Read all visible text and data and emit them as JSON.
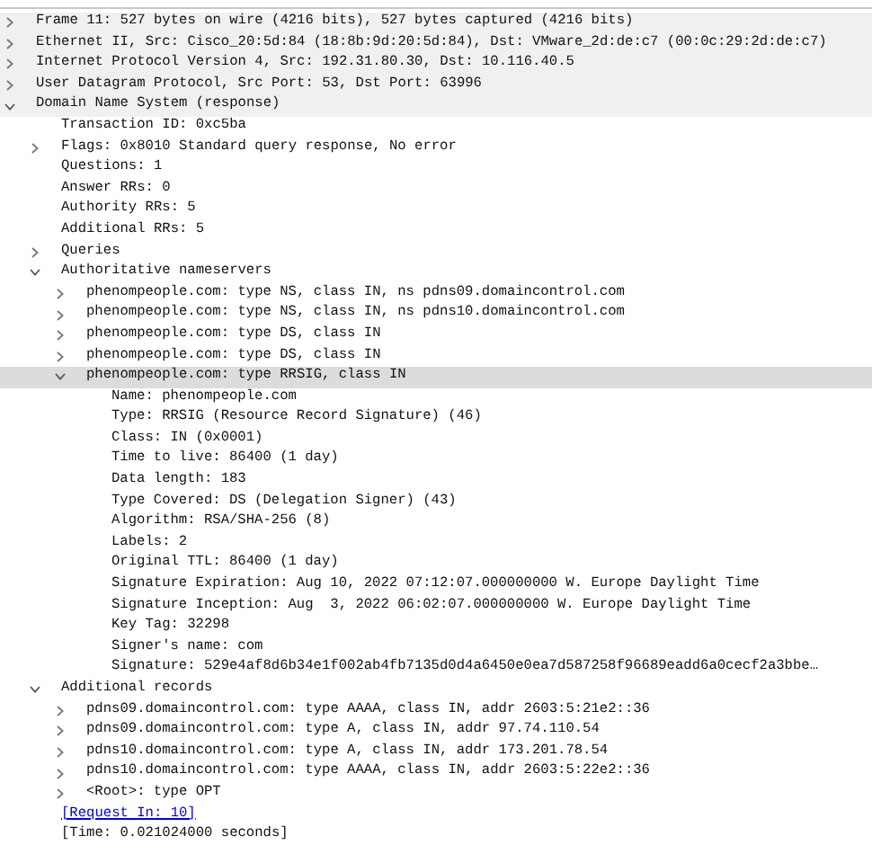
{
  "packet_details": [
    {
      "label": "Frame 11: 527 bytes on wire (4216 bits), 527 bytes captured (4216 bits)",
      "expanded": false,
      "selected": false
    },
    {
      "label": "Ethernet II, Src: Cisco_20:5d:84 (18:8b:9d:20:5d:84), Dst: VMware_2d:de:c7 (00:0c:29:2d:de:c7)",
      "expanded": false,
      "selected": false
    },
    {
      "label": "Internet Protocol Version 4, Src: 192.31.80.30, Dst: 10.116.40.5",
      "expanded": false,
      "selected": false
    },
    {
      "label": "User Datagram Protocol, Src Port: 53, Dst Port: 63996",
      "expanded": false,
      "selected": false
    },
    {
      "label": "Domain Name System (response)",
      "expanded": true,
      "selected": false,
      "children": [
        {
          "label": "Transaction ID: 0xc5ba",
          "selected": false
        },
        {
          "label": "Flags: 0x8010 Standard query response, No error",
          "expanded": false,
          "selected": false
        },
        {
          "label": "Questions: 1",
          "selected": false
        },
        {
          "label": "Answer RRs: 0",
          "selected": false
        },
        {
          "label": "Authority RRs: 5",
          "selected": false
        },
        {
          "label": "Additional RRs: 5",
          "selected": false
        },
        {
          "label": "Queries",
          "expanded": false,
          "selected": false
        },
        {
          "label": "Authoritative nameservers",
          "expanded": true,
          "selected": false,
          "children": [
            {
              "label": "phenompeople.com: type NS, class IN, ns pdns09.domaincontrol.com",
              "expanded": false,
              "selected": false
            },
            {
              "label": "phenompeople.com: type NS, class IN, ns pdns10.domaincontrol.com",
              "expanded": false,
              "selected": false
            },
            {
              "label": "phenompeople.com: type DS, class IN",
              "expanded": false,
              "selected": false
            },
            {
              "label": "phenompeople.com: type DS, class IN",
              "expanded": false,
              "selected": false
            },
            {
              "label": "phenompeople.com: type RRSIG, class IN",
              "expanded": true,
              "selected": true,
              "children": [
                {
                  "label": "Name: phenompeople.com",
                  "selected": false
                },
                {
                  "label": "Type: RRSIG (Resource Record Signature) (46)",
                  "selected": false
                },
                {
                  "label": "Class: IN (0x0001)",
                  "selected": false
                },
                {
                  "label": "Time to live: 86400 (1 day)",
                  "selected": false
                },
                {
                  "label": "Data length: 183",
                  "selected": false
                },
                {
                  "label": "Type Covered: DS (Delegation Signer) (43)",
                  "selected": false
                },
                {
                  "label": "Algorithm: RSA/SHA-256 (8)",
                  "selected": false
                },
                {
                  "label": "Labels: 2",
                  "selected": false
                },
                {
                  "label": "Original TTL: 86400 (1 day)",
                  "selected": false
                },
                {
                  "label": "Signature Expiration: Aug 10, 2022 07:12:07.000000000 W. Europe Daylight Time",
                  "selected": false
                },
                {
                  "label": "Signature Inception: Aug  3, 2022 06:02:07.000000000 W. Europe Daylight Time",
                  "selected": false
                },
                {
                  "label": "Key Tag: 32298",
                  "selected": false
                },
                {
                  "label": "Signer's name: com",
                  "selected": false
                },
                {
                  "label": "Signature: 529e4af8d6b34e1f002ab4fb7135d0d4a6450e0ea7d587258f96689eadd6a0cecf2a3bbe…",
                  "selected": false
                }
              ]
            }
          ]
        },
        {
          "label": "Additional records",
          "expanded": true,
          "selected": false,
          "children": [
            {
              "label": "pdns09.domaincontrol.com: type AAAA, class IN, addr 2603:5:21e2::36",
              "expanded": false,
              "selected": false
            },
            {
              "label": "pdns09.domaincontrol.com: type A, class IN, addr 97.74.110.54",
              "expanded": false,
              "selected": false
            },
            {
              "label": "pdns10.domaincontrol.com: type A, class IN, addr 173.201.78.54",
              "expanded": false,
              "selected": false
            },
            {
              "label": "pdns10.domaincontrol.com: type AAAA, class IN, addr 2603:5:22e2::36",
              "expanded": false,
              "selected": false
            },
            {
              "label": "<Root>: type OPT",
              "expanded": false,
              "selected": false
            }
          ]
        },
        {
          "label": "[Request In: 10]",
          "kind": "link",
          "selected": false
        },
        {
          "label": "[Time: 0.021024000 seconds]",
          "selected": false
        }
      ]
    }
  ]
}
